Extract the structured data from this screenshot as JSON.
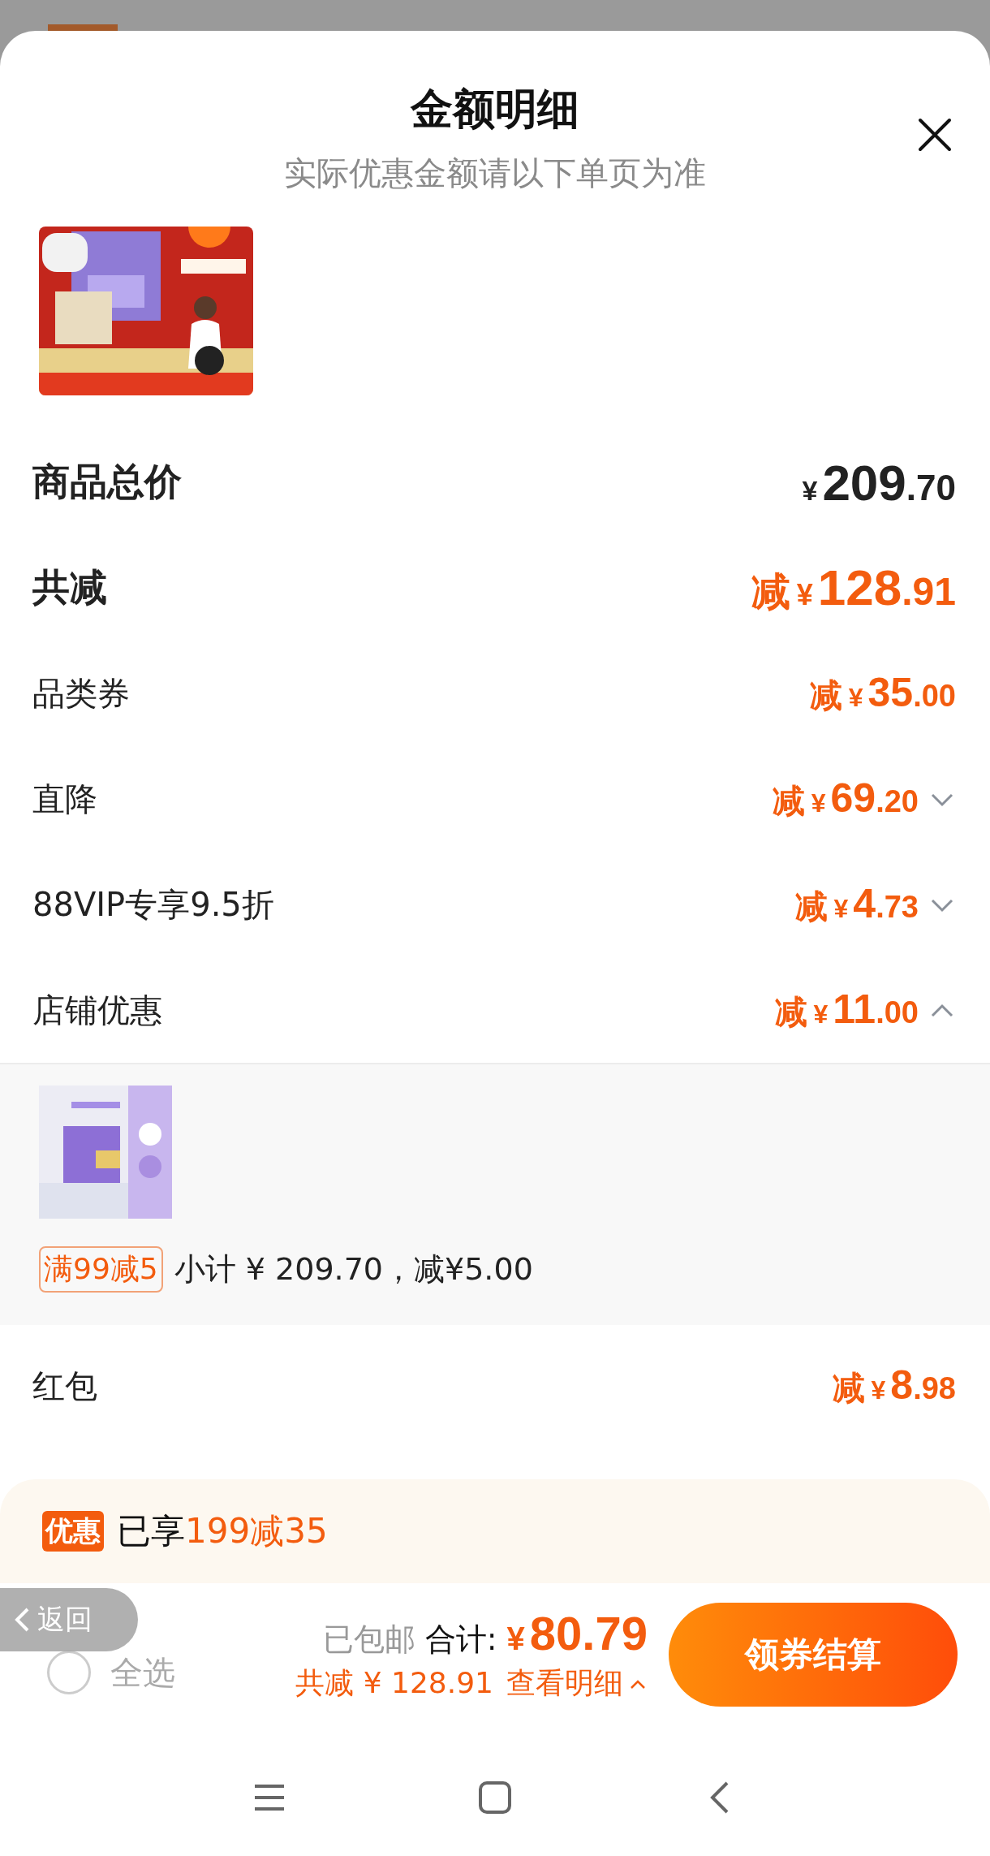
{
  "sheet": {
    "title": "金额明细",
    "subtitle": "实际优惠金额请以下单页为准"
  },
  "rows": [
    {
      "kind": "total",
      "label": "商品总价",
      "amount": {
        "currency": "¥",
        "integer": "209",
        "decimals": ".70"
      }
    },
    {
      "kind": "saving_total",
      "label": "共减",
      "amount": {
        "prefix": "减",
        "currency": "¥",
        "integer": "128",
        "decimals": ".91"
      }
    },
    {
      "kind": "saving",
      "label": "品类券",
      "amount": {
        "prefix": "减",
        "currency": "¥",
        "integer": "35",
        "decimals": ".00"
      }
    },
    {
      "kind": "saving",
      "label": "直降",
      "amount": {
        "prefix": "减",
        "currency": "¥",
        "integer": "69",
        "decimals": ".20"
      },
      "expanded": false
    },
    {
      "kind": "saving",
      "label": "88VIP专享9.5折",
      "amount": {
        "prefix": "减",
        "currency": "¥",
        "integer": "4",
        "decimals": ".73"
      },
      "expanded": false
    },
    {
      "kind": "saving",
      "label": "店铺优惠",
      "amount": {
        "prefix": "减",
        "currency": "¥",
        "integer": "11",
        "decimals": ".00"
      },
      "expanded": true,
      "detail": {
        "tag": "满99减5",
        "text": "小计 ¥ 209.70，减¥5.00"
      }
    },
    {
      "kind": "saving",
      "label": "红包",
      "amount": {
        "prefix": "减",
        "currency": "¥",
        "integer": "8",
        "decimals": ".98"
      }
    }
  ],
  "promo": {
    "badge": "优惠",
    "text": "已享",
    "highlight": "199减35"
  },
  "footer": {
    "back": "返回",
    "select_all": {
      "label": "全选",
      "checked": false
    },
    "shipping": "已包邮",
    "total_label": "合计:",
    "total_currency": "¥",
    "total": "80.79",
    "saving": "共减 ¥ 128.91",
    "details_link": "查看明细",
    "checkout": "领券结算"
  }
}
